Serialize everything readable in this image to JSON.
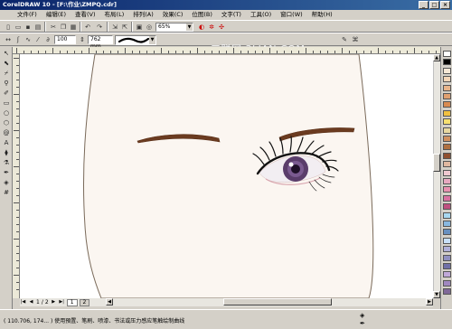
{
  "window": {
    "title": "CorelDRAW 10 - [F:\\作业\\ZMPQ.cdr]",
    "minimize": "_",
    "maximize": "□",
    "close": "×"
  },
  "menu": [
    "文件(F)",
    "编辑(E)",
    "查看(V)",
    "布局(L)",
    "排列(A)",
    "效果(C)",
    "位图(B)",
    "文字(T)",
    "工具(O)",
    "窗口(W)",
    "帮助(H)"
  ],
  "toolbar": {
    "zoom_value": "65%",
    "width_value": "100",
    "size_value": "762 mm"
  },
  "watermark": "三联网 3LIAN.COM",
  "pages": {
    "current": "1",
    "separator": "/",
    "total": "2",
    "tab1": "1",
    "tab2": "2"
  },
  "status": {
    "coordinates": "( 110.706, 174... )    使用預置、笔刷、喷漆、书法或压力感应笔触绘制曲线"
  },
  "colors": {
    "face_fill": "#fbf6f1",
    "face_outline": "#7a6a5a",
    "brow": "#6b3b20",
    "iris": "#5a3d6b",
    "lashes": "#111111",
    "accent_title": "#0a246a"
  },
  "palette": [
    "#ffffff",
    "#000000",
    "#f6e8d6",
    "#f3d6b8",
    "#e8b48a",
    "#e0a070",
    "#d88a50",
    "#f0c040",
    "#f6e070",
    "#e8d8a0",
    "#d09060",
    "#b07040",
    "#905030",
    "#e0b8a0",
    "#f0c8d0",
    "#e8a8c0",
    "#e890b0",
    "#d870a0",
    "#c05080",
    "#a8d8f0",
    "#88b8e0",
    "#6890c0",
    "#c8e0f8",
    "#b0b0d8",
    "#9090c0",
    "#7070a8",
    "#c0a8d8",
    "#a088c0",
    "#806898"
  ]
}
